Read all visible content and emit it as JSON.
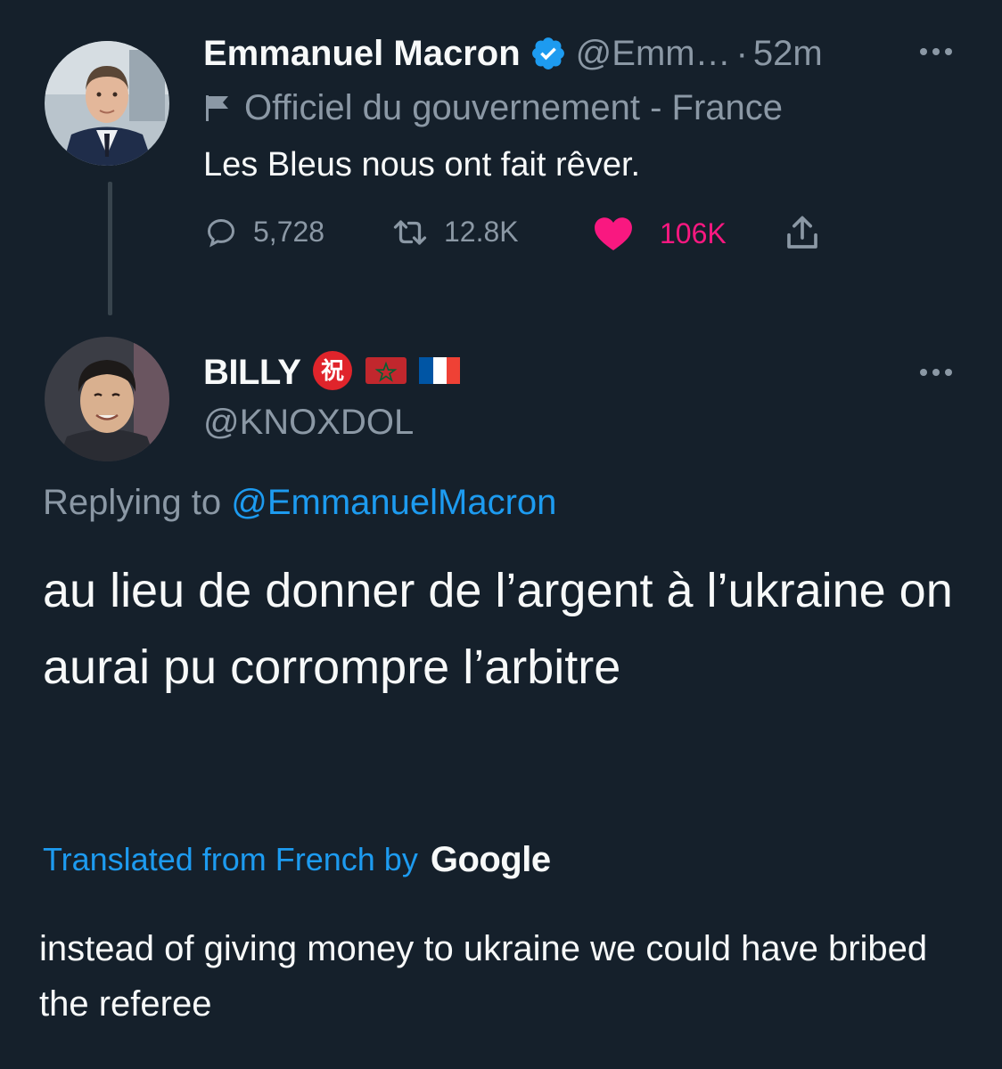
{
  "tweet1": {
    "author_name": "Emmanuel Macron",
    "handle": "@Emm…",
    "separator": "·",
    "time": "52m",
    "label": "Officiel du gouvernement - France",
    "text": "Les Bleus nous ont fait rêver.",
    "actions": {
      "replies": "5,728",
      "retweets": "12.8K",
      "likes": "106K"
    },
    "icons": [
      "verified-badge-icon",
      "government-flag-icon",
      "reply-icon",
      "retweet-icon",
      "like-icon",
      "share-icon",
      "more-icon"
    ],
    "colors": {
      "verified": "#1d9bf0",
      "like": "#f91880"
    }
  },
  "tweet2": {
    "author_name": "BILLY",
    "emojis": [
      "congratulation-emoji",
      "morocco-flag-emoji",
      "france-flag-emoji"
    ],
    "congrats_glyph": "祝",
    "handle": "@KNOXDOL",
    "replying_prefix": "Replying to",
    "replying_handle": "@EmmanuelMacron",
    "text": "au lieu de donner de l’argent à l’ukraine on aurai pu corrompre l’arbitre",
    "translated_label": "Translated from French by",
    "translator_brand": "Google",
    "translation": "instead of giving money to ukraine we could have bribed the referee"
  },
  "theme": {
    "background": "#15202b",
    "text": "#f7f9f9",
    "muted": "#8b98a5",
    "link": "#1d9bf0"
  }
}
